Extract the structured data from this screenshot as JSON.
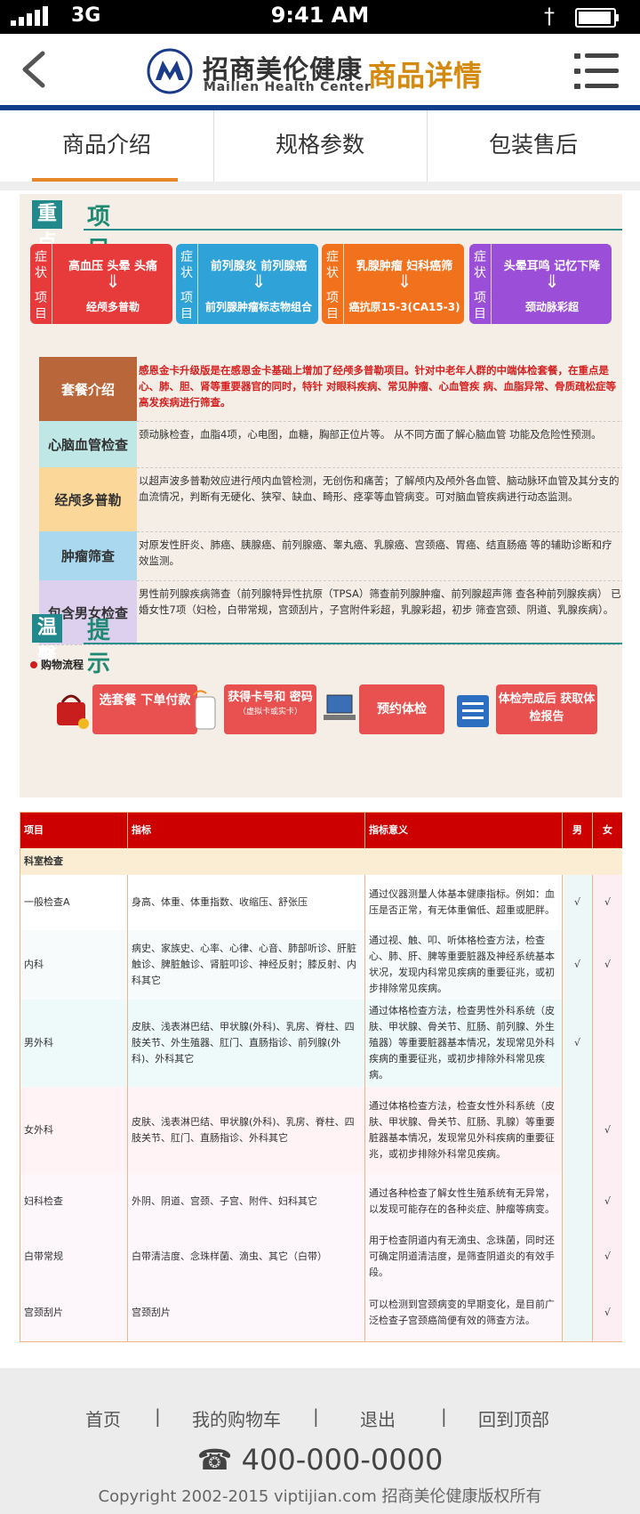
{
  "status": {
    "carrier": "3G",
    "time": "9:41 AM"
  },
  "header": {
    "brand_cn": "招商美伦健康",
    "brand_en": "Maillen Health Center",
    "title": "商品详情"
  },
  "tabs": [
    "商品介绍",
    "规格参数",
    "包装售后"
  ],
  "sections": {
    "key_a": "重点",
    "key_b": "项目",
    "tip_a": "温馨",
    "tip_b": "提示"
  },
  "cards": [
    {
      "side_top": "症状",
      "side_bottom": "项目",
      "top": "高血压 头晕 头痛",
      "bottom": "经颅多普勒",
      "color": "#e73b3b"
    },
    {
      "side_top": "症状",
      "side_bottom": "项目",
      "top": "前列腺炎 前列腺癌",
      "bottom": "前列腺肿瘤标志物组合",
      "color": "#2fa3d8"
    },
    {
      "side_top": "症状",
      "side_bottom": "项目",
      "top": "乳腺肿瘤 妇科癌筛",
      "bottom": "癌抗原15-3(CA15-3)",
      "color": "#f2711c"
    },
    {
      "side_top": "症状",
      "side_bottom": "项目",
      "top": "头晕耳鸣 记忆下降",
      "bottom": "颈动脉彩超",
      "color": "#9b4fd8"
    }
  ],
  "package": [
    {
      "label": "套餐介绍",
      "text": "感恩金卡升级版是在感恩金卡基础上增加了经颅多普勒项目。针对中老年人群的中端体检套餐，在重点是心、肺、胆、肾等重要器官的同时，特针 对眼科疾病、常见肿瘤、心血管疾 病、血脂异常、骨质疏松症等高发疾病进行筛查。",
      "label_bg": "#b8663a",
      "label_color": "#ffffff",
      "red": true
    },
    {
      "label": "心脑血管检查",
      "text": "颈动脉检查，血脂4项，心电图，血糖，胸部正位片等。 从不同方面了解心脑血管 功能及危险性预测。",
      "label_bg": "#bfe7e6",
      "label_color": "#333333",
      "red": false
    },
    {
      "label": "经颅多普勒",
      "text": "以超声波多普勒效应进行颅内血管检测，无创伤和痛苦；了解颅内及颅外各血管、脑动脉环血管及其分支的血流情况，判断有无硬化、狭窄、缺血、畸形、痉挛等血管病变。可对脑血管疾病进行动态监测。",
      "label_bg": "#fbd79a",
      "label_color": "#333333",
      "red": false
    },
    {
      "label": "肿瘤筛查",
      "text": "对原发性肝炎、肺癌、胰腺癌、前列腺癌、睾丸癌、乳腺癌、宫颈癌、胃癌、结直肠癌 等的辅助诊断和疗效监测。",
      "label_bg": "#a9d8ef",
      "label_color": "#333333",
      "red": false
    },
    {
      "label": "包含男女检查",
      "text": "男性前列腺疾病筛查（前列腺特异性抗原（TPSA）筛查前列腺肿瘤、前列腺超声筛 查各种前列腺疾病）  已婚女性7项（妇检，白带常规，宫颈刮片，子宫附件彩超，乳腺彩超，初步 筛查宫颈、阴道、乳腺疾病）。",
      "label_bg": "#ddd0ef",
      "label_color": "#333333",
      "red": false
    }
  ],
  "flow": {
    "title": "购物流程",
    "steps": [
      "选套餐 下单付款",
      "获得卡号和 密码",
      "预约体检",
      "体检完成后 获取体检报告"
    ],
    "step2_note": "（虚拟卡或实卡）"
  },
  "table": {
    "headers": [
      "项目",
      "指标",
      "指标意义",
      "男",
      "女"
    ],
    "group": "科室检查",
    "rows": [
      {
        "item": "一般检查A",
        "index": "身高、体重、体重指数、收缩压、舒张压",
        "meaning": "通过仪器测量人体基本健康指标。例如：血压是否正常，有无体重偏低、超重或肥胖。",
        "male": "√",
        "female": "√"
      },
      {
        "item": "内科",
        "index": "病史、家族史、心率、心律、心音、肺部听诊、肝脏触诊、脾脏触诊、肾脏叩诊、神经反射；膝反射、内科其它",
        "meaning": "通过视、触、叩、听体格检查方法，检查心、肺、肝、脾等重要脏器及神经系统基本状况，发现内科常见疾病的重要征兆，或初步排除常见疾病。",
        "male": "√",
        "female": "√"
      },
      {
        "item": "男外科",
        "index": "皮肤、浅表淋巴结、甲状腺(外科)、乳房、脊柱、四肢关节、外生殖器、肛门、直肠指诊、前列腺(外科)、外科其它",
        "meaning": "通过体格检查方法，检查男性外科系统（皮肤、甲状腺、骨关节、肛肠、前列腺、外生殖器）等重要脏器基本情况，发现常见外科疾病的重要征兆，或初步排除外科常见疾病。",
        "male": "√",
        "female": ""
      },
      {
        "item": "女外科",
        "index": "皮肤、浅表淋巴结、甲状腺(外科)、乳房、脊柱、四肢关节、肛门、直肠指诊、外科其它",
        "meaning": "通过体格检查方法，检查女性外科系统（皮肤、甲状腺、骨关节、肛肠、乳腺）等重要脏器基本情况，发现常见外科疾病的重要征兆，或初步排除外科常见疾病。",
        "male": "",
        "female": "√"
      },
      {
        "item": "妇科检查",
        "index": "外阴、阴道、宫颈、子宫、附件、妇科其它",
        "meaning": "通过各种检查了解女性生殖系统有无异常，以发现可能存在的各种炎症、肿瘤等病变。",
        "male": "",
        "female": "√"
      },
      {
        "item": "白带常规",
        "index": "白带清洁度、念珠样菌、滴虫、其它（白带）",
        "meaning": "用于检查阴道内有无滴虫、念珠菌，同时还可确定阴道清洁度，是筛查阴道炎的有效手段。",
        "male": "",
        "female": "√"
      },
      {
        "item": "宫颈刮片",
        "index": "宫颈刮片",
        "meaning": "可以检测到宫颈病变的早期变化，是目前广泛检查子宫颈癌简便有效的筛查方法。",
        "male": "",
        "female": "√"
      }
    ]
  },
  "footer": {
    "nav": [
      "首页",
      "我的购物车",
      "退出",
      "回到顶部"
    ],
    "separator": "|",
    "phone": "400-000-0000",
    "copyright": "Copyright 2002-2015 viptijian.com  招商美伦健康版权所有"
  }
}
